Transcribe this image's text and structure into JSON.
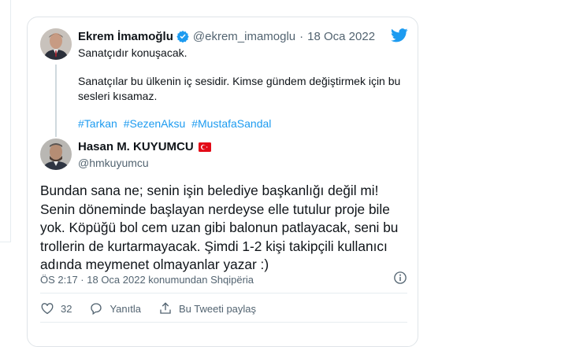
{
  "quoted_tweet": {
    "name": "Ekrem İmamoğlu",
    "handle": "@ekrem_imamoglu",
    "separator": "·",
    "date": "18 Oca 2022",
    "line1": "Sanatçıdır konuşacak.",
    "paragraph": "Sanatçılar bu ülkenin iç sesidir. Kimse gündem değiştirmek için bu sesleri kısamaz.",
    "hashtags": [
      "#Tarkan",
      "#SezenAksu",
      "#MustafaSandal"
    ]
  },
  "reply_tweet": {
    "name": "Hasan M. KUYUMCU",
    "handle": "@hmkuyumcu",
    "body": "Bundan sana ne; senin işin belediye başkanlığı değil mi! Senin döneminde başlayan nerdeyse elle tutulur proje bile yok. Köpüğü bol cem uzan gibi balonun patlayacak, seni bu trollerin de kurtarmayacak. Şimdi 1-2 kişi takipçili kullanıcı adında meymenet olmayanlar yazar :)",
    "meta": "ÖS 2:17 · 18 Oca 2022 konumundan Shqipëria"
  },
  "actions": {
    "like_count": "32",
    "reply_label": "Yanıtla",
    "share_label": "Bu Tweeti paylaş"
  },
  "colors": {
    "accent": "#1d9bf0",
    "text": "#0f1419",
    "secondary": "#536471",
    "border": "#dfe4e8"
  },
  "icons": [
    "verified-badge-icon",
    "twitter-bird-icon",
    "turkey-flag-icon",
    "info-icon",
    "heart-icon",
    "reply-icon",
    "share-icon"
  ]
}
